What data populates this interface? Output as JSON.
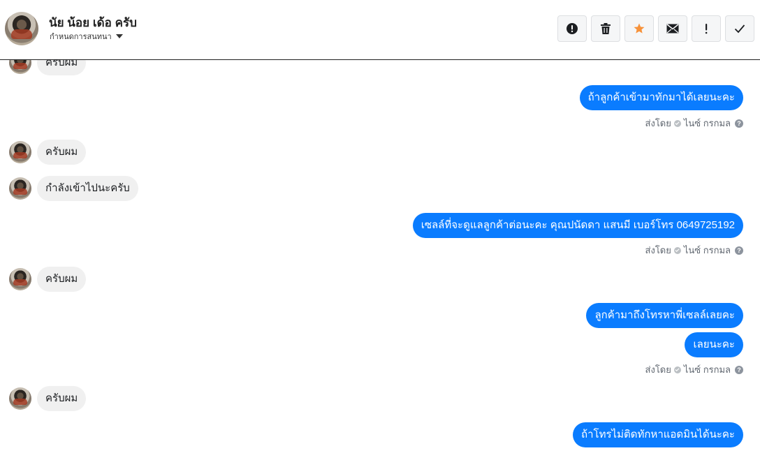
{
  "header": {
    "contact_name": "นัย น้อย เด้อ ครับ",
    "status_label": "กำหนดการสนทนา",
    "actions": [
      {
        "icon": "alert-circle-icon",
        "name": "mark-spam-button"
      },
      {
        "icon": "trash-icon",
        "name": "delete-button"
      },
      {
        "icon": "star-icon",
        "name": "star-button",
        "color": "#f7923a"
      },
      {
        "icon": "envelope-icon",
        "name": "mark-unread-button"
      },
      {
        "icon": "exclamation-icon",
        "name": "follow-up-button"
      },
      {
        "icon": "check-icon",
        "name": "mark-done-button"
      }
    ]
  },
  "colors": {
    "outgoing_bubble": "#0a7cff",
    "incoming_bubble": "#f0f0f0"
  },
  "messages": [
    {
      "dir": "in",
      "text": "ครับผม"
    },
    {
      "dir": "out",
      "text": "ถ้าลูกค้าเข้ามาทักมาได้เลยนะคะ"
    },
    {
      "dir": "meta",
      "sent_by": "ส่งโดย",
      "sender": "ไนซ์ กรกมล"
    },
    {
      "dir": "in",
      "text": "ครับผม"
    },
    {
      "dir": "in",
      "text": "กำลังเข้าไปนะครับ"
    },
    {
      "dir": "out",
      "text": "เซลล์ที่จะดูแลลูกค้าต่อนะคะ คุณปนัดดา แสนมี    เบอร์โทร 0649725192"
    },
    {
      "dir": "meta",
      "sent_by": "ส่งโดย",
      "sender": "ไนซ์ กรกมล"
    },
    {
      "dir": "in",
      "text": "ครับผม"
    },
    {
      "dir": "out",
      "text": "ลูกค้ามาถึงโทรหาพี่เซลล์เลยคะ"
    },
    {
      "dir": "out",
      "text": "เลยนะคะ"
    },
    {
      "dir": "meta",
      "sent_by": "ส่งโดย",
      "sender": "ไนซ์ กรกมล"
    },
    {
      "dir": "in",
      "text": "ครับผม"
    },
    {
      "dir": "out",
      "text": "ถ้าโทรไม่ติดทักหาแอดมินได้นะคะ"
    }
  ]
}
